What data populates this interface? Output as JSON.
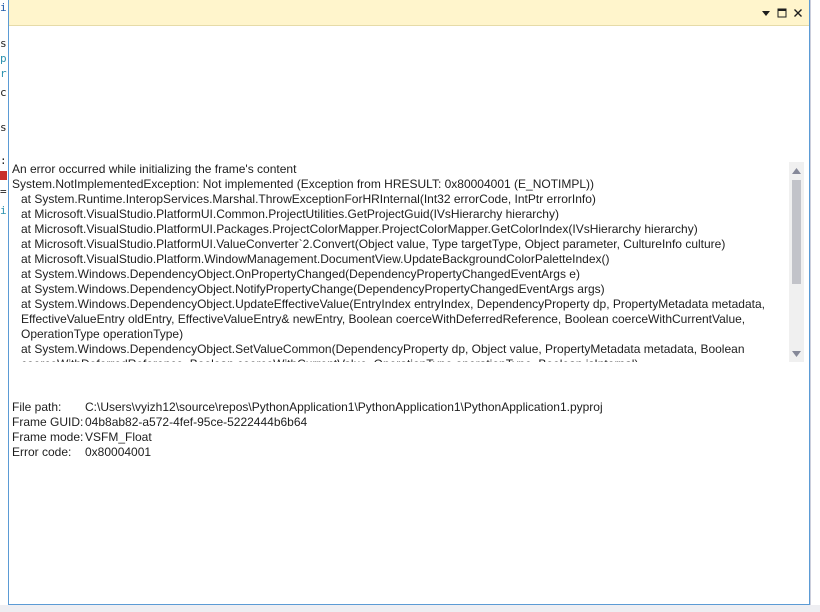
{
  "gutter": {
    "fragments": [
      {
        "text": "i",
        "cls": "blue"
      },
      {
        "text": "s",
        "cls": "dark"
      },
      {
        "text": "p",
        "cls": "teal"
      },
      {
        "text": "r",
        "cls": "teal"
      },
      {
        "text": "c",
        "cls": "dark"
      },
      {
        "text": "s",
        "cls": "dark"
      },
      {
        "text": ":",
        "cls": "dark"
      },
      {
        "text": "=",
        "cls": "dark"
      },
      {
        "text": "i",
        "cls": "teal"
      }
    ]
  },
  "titlebar": {
    "buttons": [
      {
        "name": "dropdown-button",
        "icon": "dropdown-arrow-icon"
      },
      {
        "name": "maximize-button",
        "icon": "maximize-icon"
      },
      {
        "name": "close-button",
        "icon": "close-icon"
      }
    ]
  },
  "error": {
    "heading": "An error occurred while initializing the frame's content",
    "exception": "System.NotImplementedException: Not implemented (Exception from HRESULT: 0x80004001 (E_NOTIMPL))",
    "stack": [
      "at System.Runtime.InteropServices.Marshal.ThrowExceptionForHRInternal(Int32 errorCode, IntPtr errorInfo)",
      "at Microsoft.VisualStudio.PlatformUI.Common.ProjectUtilities.GetProjectGuid(IVsHierarchy hierarchy)",
      "at Microsoft.VisualStudio.PlatformUI.Packages.ProjectColorMapper.ProjectColorMapper.GetColorIndex(IVsHierarchy hierarchy)",
      "at Microsoft.VisualStudio.PlatformUI.ValueConverter`2.Convert(Object value, Type targetType, Object parameter, CultureInfo culture)",
      "at Microsoft.VisualStudio.Platform.WindowManagement.DocumentView.UpdateBackgroundColorPaletteIndex()",
      "at System.Windows.DependencyObject.OnPropertyChanged(DependencyPropertyChangedEventArgs e)",
      "at System.Windows.DependencyObject.NotifyPropertyChange(DependencyPropertyChangedEventArgs args)",
      "at System.Windows.DependencyObject.UpdateEffectiveValue(EntryIndex entryIndex, DependencyProperty dp, PropertyMetadata metadata, EffectiveValueEntry oldEntry, EffectiveValueEntry& newEntry, Boolean coerceWithDeferredReference, Boolean coerceWithCurrentValue, OperationType operationType)",
      "at System.Windows.DependencyObject.SetValueCommon(DependencyProperty dp, Object value, PropertyMetadata metadata, Boolean coerceWithDeferredReference, Boolean coerceWithCurrentValue, OperationType operationType, Boolean isInternal)"
    ]
  },
  "details": {
    "file_path_label": "File path:",
    "file_path": "C:\\Users\\vyizh12\\source\\repos\\PythonApplication1\\PythonApplication1\\PythonApplication1.pyproj",
    "frame_guid_label": "Frame GUID:",
    "frame_guid": "04b8ab82-a572-4fef-95ce-5222444b6b64",
    "frame_mode_label": "Frame mode:",
    "frame_mode": "VSFM_Float",
    "error_code_label": "Error code:",
    "error_code": "0x80004001"
  },
  "colors": {
    "titlebar_bg": "#fff5cc",
    "window_border": "#5b9bd5",
    "scrollbar_thumb": "#c2c3c9",
    "error_marker": "#c8302a"
  }
}
